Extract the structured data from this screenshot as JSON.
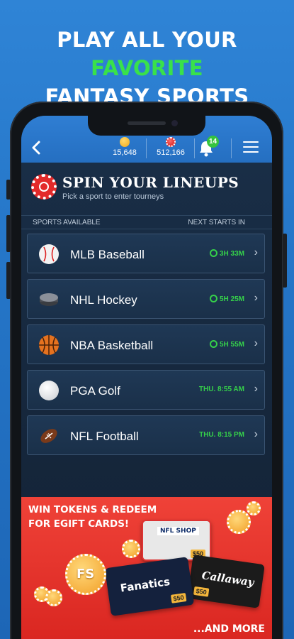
{
  "promo": {
    "line1_a": "PLAY ALL YOUR ",
    "line1_b": "FAVORITE",
    "line2": "FANTASY SPORTS"
  },
  "topbar": {
    "tokens_value": "15,648",
    "chips_value": "512,166",
    "notifications_count": "14"
  },
  "hero": {
    "title": "SPIN YOUR LINEUPS",
    "subtitle": "Pick a sport to enter tourneys"
  },
  "columns": {
    "left": "SPORTS AVAILABLE",
    "right": "NEXT STARTS IN"
  },
  "sports": [
    {
      "name": "MLB Baseball",
      "time": "3H 33M",
      "has_clock": true,
      "icon": "baseball-icon"
    },
    {
      "name": "NHL Hockey",
      "time": "5H 25M",
      "has_clock": true,
      "icon": "hockey-puck-icon"
    },
    {
      "name": "NBA Basketball",
      "time": "5H 55M",
      "has_clock": true,
      "icon": "basketball-icon"
    },
    {
      "name": "PGA Golf",
      "time": "THU. 8:55 AM",
      "has_clock": false,
      "icon": "golf-ball-icon"
    },
    {
      "name": "NFL Football",
      "time": "THU. 8:15 PM",
      "has_clock": false,
      "icon": "football-icon"
    }
  ],
  "banner": {
    "line1": "WIN TOKENS & REDEEM",
    "line2": "FOR EGIFT CARDS!",
    "cards": [
      "Fanatics",
      "Callaway",
      "NFL SHOP"
    ],
    "price": "$50",
    "token_label": "FS",
    "footer": "...AND MORE"
  },
  "colors": {
    "accent_green": "#39e14a",
    "topbar_blue": "#2f7ed3",
    "banner_red": "#e0302a"
  }
}
